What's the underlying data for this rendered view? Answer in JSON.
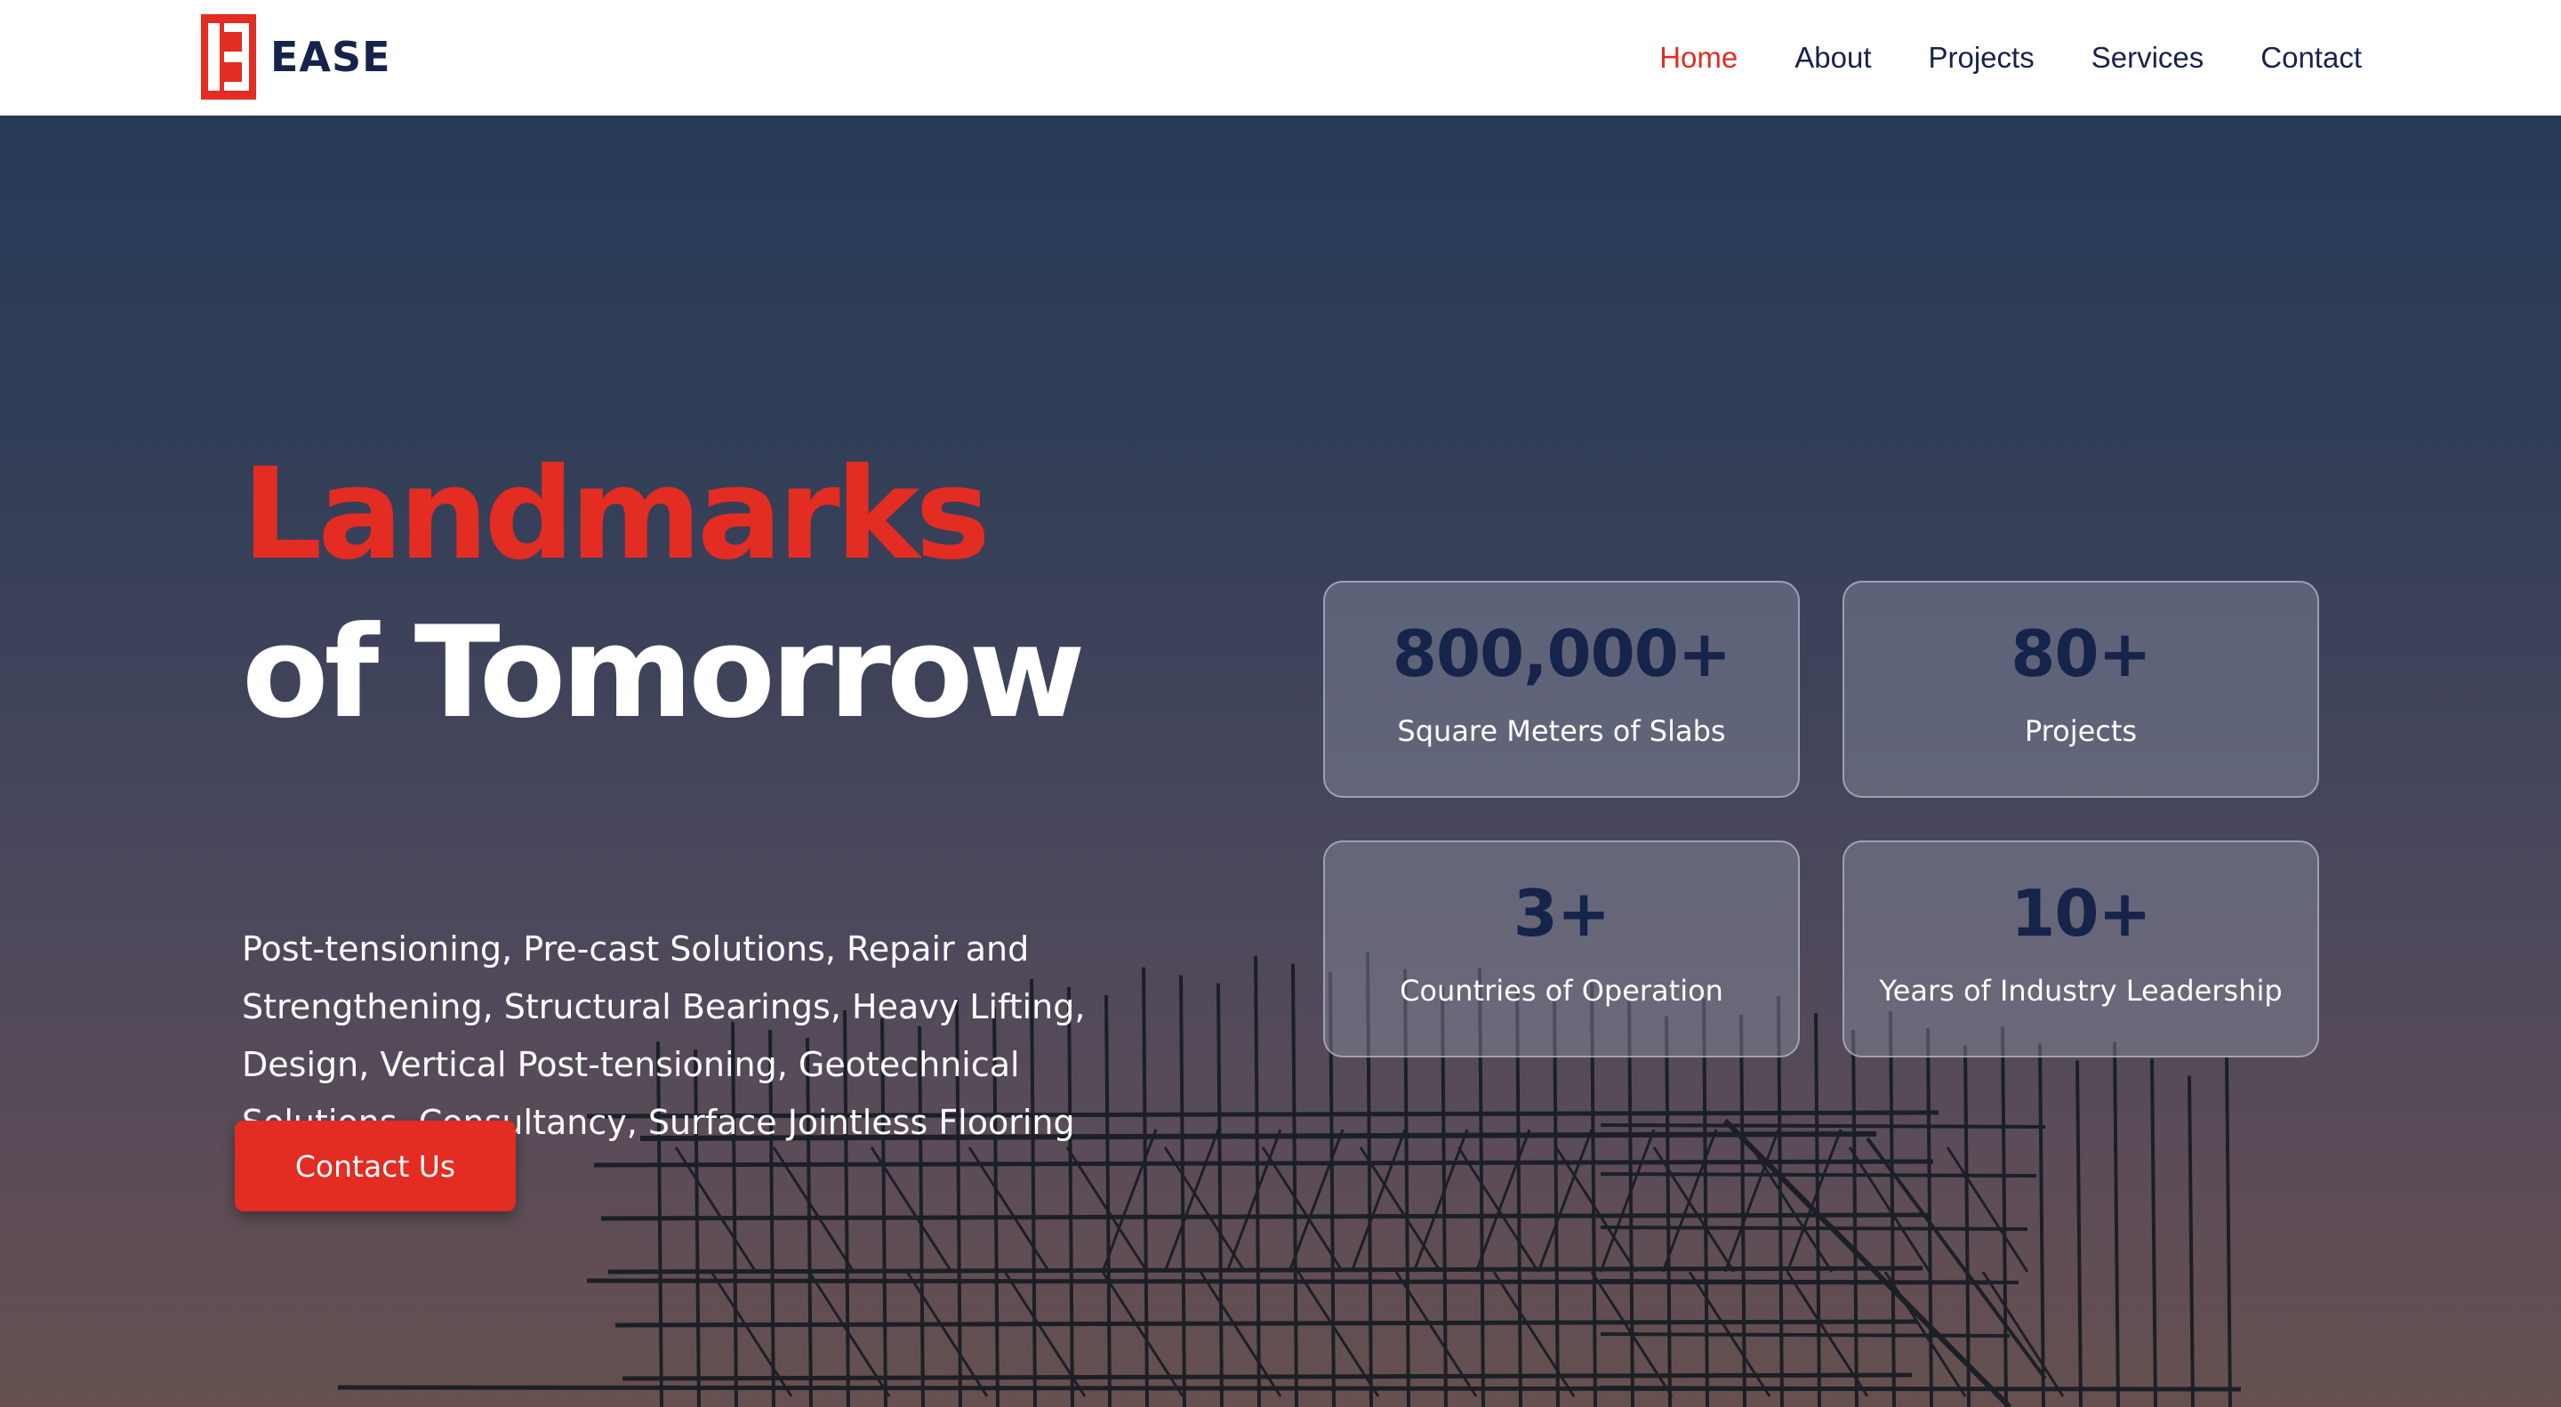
{
  "brand": {
    "name": "EASE",
    "accent": "#e32c22",
    "navy": "#16234a"
  },
  "nav": {
    "items": [
      {
        "label": "Home",
        "active": true
      },
      {
        "label": "About",
        "active": false
      },
      {
        "label": "Projects",
        "active": false
      },
      {
        "label": "Services",
        "active": false
      },
      {
        "label": "Contact",
        "active": false
      }
    ]
  },
  "hero": {
    "headline_line1": "Landmarks",
    "headline_line2": "of Tomorrow",
    "description": "Post-tensioning, Pre-cast Solutions, Repair and Strengthening, Structural Bearings, Heavy Lifting, Design, Vertical Post-tensioning, Geotechnical Solutions, Consultancy, Surface Jointless Flooring",
    "cta_label": "Contact Us",
    "background": "scaffolding-silhouette-at-dusk"
  },
  "stats": [
    {
      "value": "800,000+",
      "label": "Square Meters of Slabs"
    },
    {
      "value": "80+",
      "label": "Projects"
    },
    {
      "value": "3+",
      "label": "Countries of Operation"
    },
    {
      "value": "10+",
      "label": "Years of Industry Leadership"
    }
  ]
}
